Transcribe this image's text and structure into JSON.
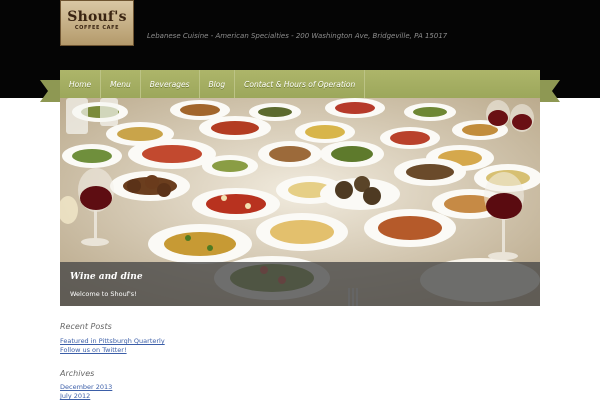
{
  "site": {
    "logo_main": "Shouf's",
    "logo_sub": "COFFEE CAFE",
    "tagline": "Lebanese Cuisine - American Specialties - 200 Washington Ave, Bridgeville, PA 15017"
  },
  "nav": {
    "items": [
      {
        "label": "Home"
      },
      {
        "label": "Menu"
      },
      {
        "label": "Beverages"
      },
      {
        "label": "Blog"
      },
      {
        "label": "Contact & Hours of Operation"
      }
    ]
  },
  "slider": {
    "title": "Wine and dine",
    "subtitle": "Welcome to Shouf's!"
  },
  "recent_posts": {
    "title": "Recent Posts",
    "items": [
      {
        "label": "Featured in Pittsburgh Quarterly"
      },
      {
        "label": "Follow us on Twitter!"
      }
    ]
  },
  "archives": {
    "title": "Archives",
    "items": [
      {
        "label": "December 2013"
      },
      {
        "label": "July 2012"
      }
    ]
  },
  "colors": {
    "header_bg": "#050505",
    "nav_green": "#a3ad62",
    "link_blue": "#3b5ea8"
  }
}
